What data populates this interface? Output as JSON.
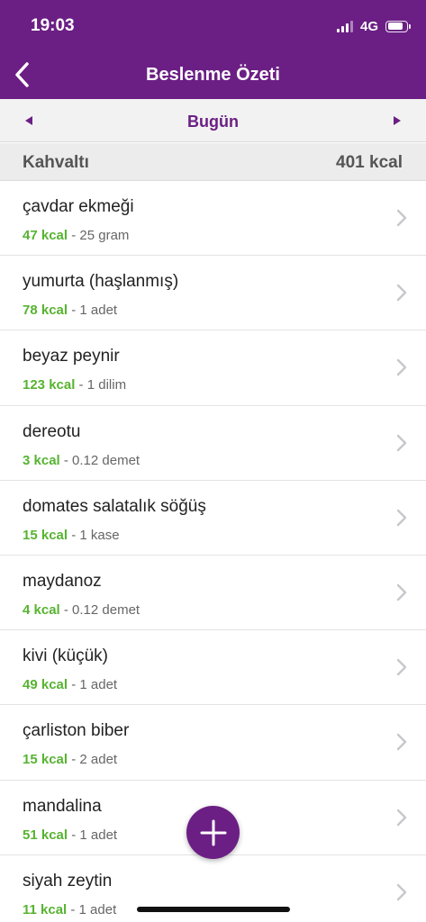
{
  "status_bar": {
    "time": "19:03",
    "network": "4G"
  },
  "header": {
    "title": "Beslenme Özeti"
  },
  "date_nav": {
    "label": "Bugün"
  },
  "meal": {
    "name": "Kahvaltı",
    "total": "401 kcal"
  },
  "items": [
    {
      "name": "çavdar ekmeği",
      "kcal": "47 kcal",
      "amount": " - 25 gram"
    },
    {
      "name": "yumurta (haşlanmış)",
      "kcal": "78 kcal",
      "amount": " - 1 adet"
    },
    {
      "name": "beyaz peynir",
      "kcal": "123 kcal",
      "amount": " - 1 dilim"
    },
    {
      "name": "dereotu",
      "kcal": "3 kcal",
      "amount": " - 0.12 demet"
    },
    {
      "name": "domates salatalık söğüş",
      "kcal": "15 kcal",
      "amount": " - 1 kase"
    },
    {
      "name": "maydanoz",
      "kcal": "4 kcal",
      "amount": " - 0.12 demet"
    },
    {
      "name": "kivi (küçük)",
      "kcal": "49 kcal",
      "amount": " - 1 adet"
    },
    {
      "name": "çarliston biber",
      "kcal": "15 kcal",
      "amount": " - 2 adet"
    },
    {
      "name": "mandalina",
      "kcal": "51 kcal",
      "amount": " - 1 adet"
    },
    {
      "name": "siyah zeytin",
      "kcal": "11 kcal",
      "amount": " - 1 adet"
    }
  ],
  "colors": {
    "brand": "#6b1f84",
    "kcal": "#57b331"
  },
  "icons": {
    "back": "chevron-left-icon",
    "prev": "triangle-left-icon",
    "next": "triangle-right-icon",
    "row": "chevron-right-icon",
    "add": "plus-icon"
  }
}
